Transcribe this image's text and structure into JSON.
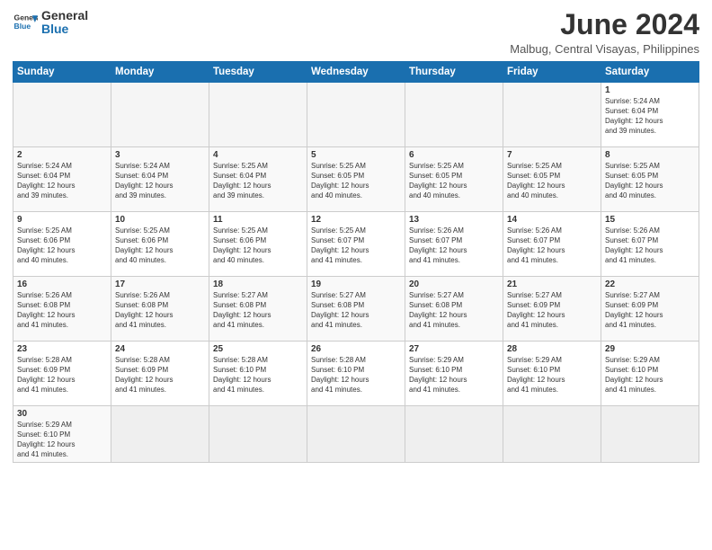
{
  "logo": {
    "line1": "General",
    "line2": "Blue"
  },
  "title": "June 2024",
  "subtitle": "Malbug, Central Visayas, Philippines",
  "days_of_week": [
    "Sunday",
    "Monday",
    "Tuesday",
    "Wednesday",
    "Thursday",
    "Friday",
    "Saturday"
  ],
  "weeks": [
    [
      {
        "day": "",
        "info": ""
      },
      {
        "day": "",
        "info": ""
      },
      {
        "day": "",
        "info": ""
      },
      {
        "day": "",
        "info": ""
      },
      {
        "day": "",
        "info": ""
      },
      {
        "day": "",
        "info": ""
      },
      {
        "day": "1",
        "info": "Sunrise: 5:24 AM\nSunset: 6:04 PM\nDaylight: 12 hours\nand 39 minutes."
      }
    ],
    [
      {
        "day": "2",
        "info": "Sunrise: 5:24 AM\nSunset: 6:04 PM\nDaylight: 12 hours\nand 39 minutes."
      },
      {
        "day": "3",
        "info": "Sunrise: 5:24 AM\nSunset: 6:04 PM\nDaylight: 12 hours\nand 39 minutes."
      },
      {
        "day": "4",
        "info": "Sunrise: 5:25 AM\nSunset: 6:04 PM\nDaylight: 12 hours\nand 39 minutes."
      },
      {
        "day": "5",
        "info": "Sunrise: 5:25 AM\nSunset: 6:05 PM\nDaylight: 12 hours\nand 40 minutes."
      },
      {
        "day": "6",
        "info": "Sunrise: 5:25 AM\nSunset: 6:05 PM\nDaylight: 12 hours\nand 40 minutes."
      },
      {
        "day": "7",
        "info": "Sunrise: 5:25 AM\nSunset: 6:05 PM\nDaylight: 12 hours\nand 40 minutes."
      },
      {
        "day": "8",
        "info": "Sunrise: 5:25 AM\nSunset: 6:05 PM\nDaylight: 12 hours\nand 40 minutes."
      }
    ],
    [
      {
        "day": "9",
        "info": "Sunrise: 5:25 AM\nSunset: 6:06 PM\nDaylight: 12 hours\nand 40 minutes."
      },
      {
        "day": "10",
        "info": "Sunrise: 5:25 AM\nSunset: 6:06 PM\nDaylight: 12 hours\nand 40 minutes."
      },
      {
        "day": "11",
        "info": "Sunrise: 5:25 AM\nSunset: 6:06 PM\nDaylight: 12 hours\nand 40 minutes."
      },
      {
        "day": "12",
        "info": "Sunrise: 5:25 AM\nSunset: 6:07 PM\nDaylight: 12 hours\nand 41 minutes."
      },
      {
        "day": "13",
        "info": "Sunrise: 5:26 AM\nSunset: 6:07 PM\nDaylight: 12 hours\nand 41 minutes."
      },
      {
        "day": "14",
        "info": "Sunrise: 5:26 AM\nSunset: 6:07 PM\nDaylight: 12 hours\nand 41 minutes."
      },
      {
        "day": "15",
        "info": "Sunrise: 5:26 AM\nSunset: 6:07 PM\nDaylight: 12 hours\nand 41 minutes."
      }
    ],
    [
      {
        "day": "16",
        "info": "Sunrise: 5:26 AM\nSunset: 6:08 PM\nDaylight: 12 hours\nand 41 minutes."
      },
      {
        "day": "17",
        "info": "Sunrise: 5:26 AM\nSunset: 6:08 PM\nDaylight: 12 hours\nand 41 minutes."
      },
      {
        "day": "18",
        "info": "Sunrise: 5:27 AM\nSunset: 6:08 PM\nDaylight: 12 hours\nand 41 minutes."
      },
      {
        "day": "19",
        "info": "Sunrise: 5:27 AM\nSunset: 6:08 PM\nDaylight: 12 hours\nand 41 minutes."
      },
      {
        "day": "20",
        "info": "Sunrise: 5:27 AM\nSunset: 6:08 PM\nDaylight: 12 hours\nand 41 minutes."
      },
      {
        "day": "21",
        "info": "Sunrise: 5:27 AM\nSunset: 6:09 PM\nDaylight: 12 hours\nand 41 minutes."
      },
      {
        "day": "22",
        "info": "Sunrise: 5:27 AM\nSunset: 6:09 PM\nDaylight: 12 hours\nand 41 minutes."
      }
    ],
    [
      {
        "day": "23",
        "info": "Sunrise: 5:28 AM\nSunset: 6:09 PM\nDaylight: 12 hours\nand 41 minutes."
      },
      {
        "day": "24",
        "info": "Sunrise: 5:28 AM\nSunset: 6:09 PM\nDaylight: 12 hours\nand 41 minutes."
      },
      {
        "day": "25",
        "info": "Sunrise: 5:28 AM\nSunset: 6:10 PM\nDaylight: 12 hours\nand 41 minutes."
      },
      {
        "day": "26",
        "info": "Sunrise: 5:28 AM\nSunset: 6:10 PM\nDaylight: 12 hours\nand 41 minutes."
      },
      {
        "day": "27",
        "info": "Sunrise: 5:29 AM\nSunset: 6:10 PM\nDaylight: 12 hours\nand 41 minutes."
      },
      {
        "day": "28",
        "info": "Sunrise: 5:29 AM\nSunset: 6:10 PM\nDaylight: 12 hours\nand 41 minutes."
      },
      {
        "day": "29",
        "info": "Sunrise: 5:29 AM\nSunset: 6:10 PM\nDaylight: 12 hours\nand 41 minutes."
      }
    ],
    [
      {
        "day": "30",
        "info": "Sunrise: 5:29 AM\nSunset: 6:10 PM\nDaylight: 12 hours\nand 41 minutes."
      },
      {
        "day": "",
        "info": ""
      },
      {
        "day": "",
        "info": ""
      },
      {
        "day": "",
        "info": ""
      },
      {
        "day": "",
        "info": ""
      },
      {
        "day": "",
        "info": ""
      },
      {
        "day": "",
        "info": ""
      }
    ]
  ]
}
